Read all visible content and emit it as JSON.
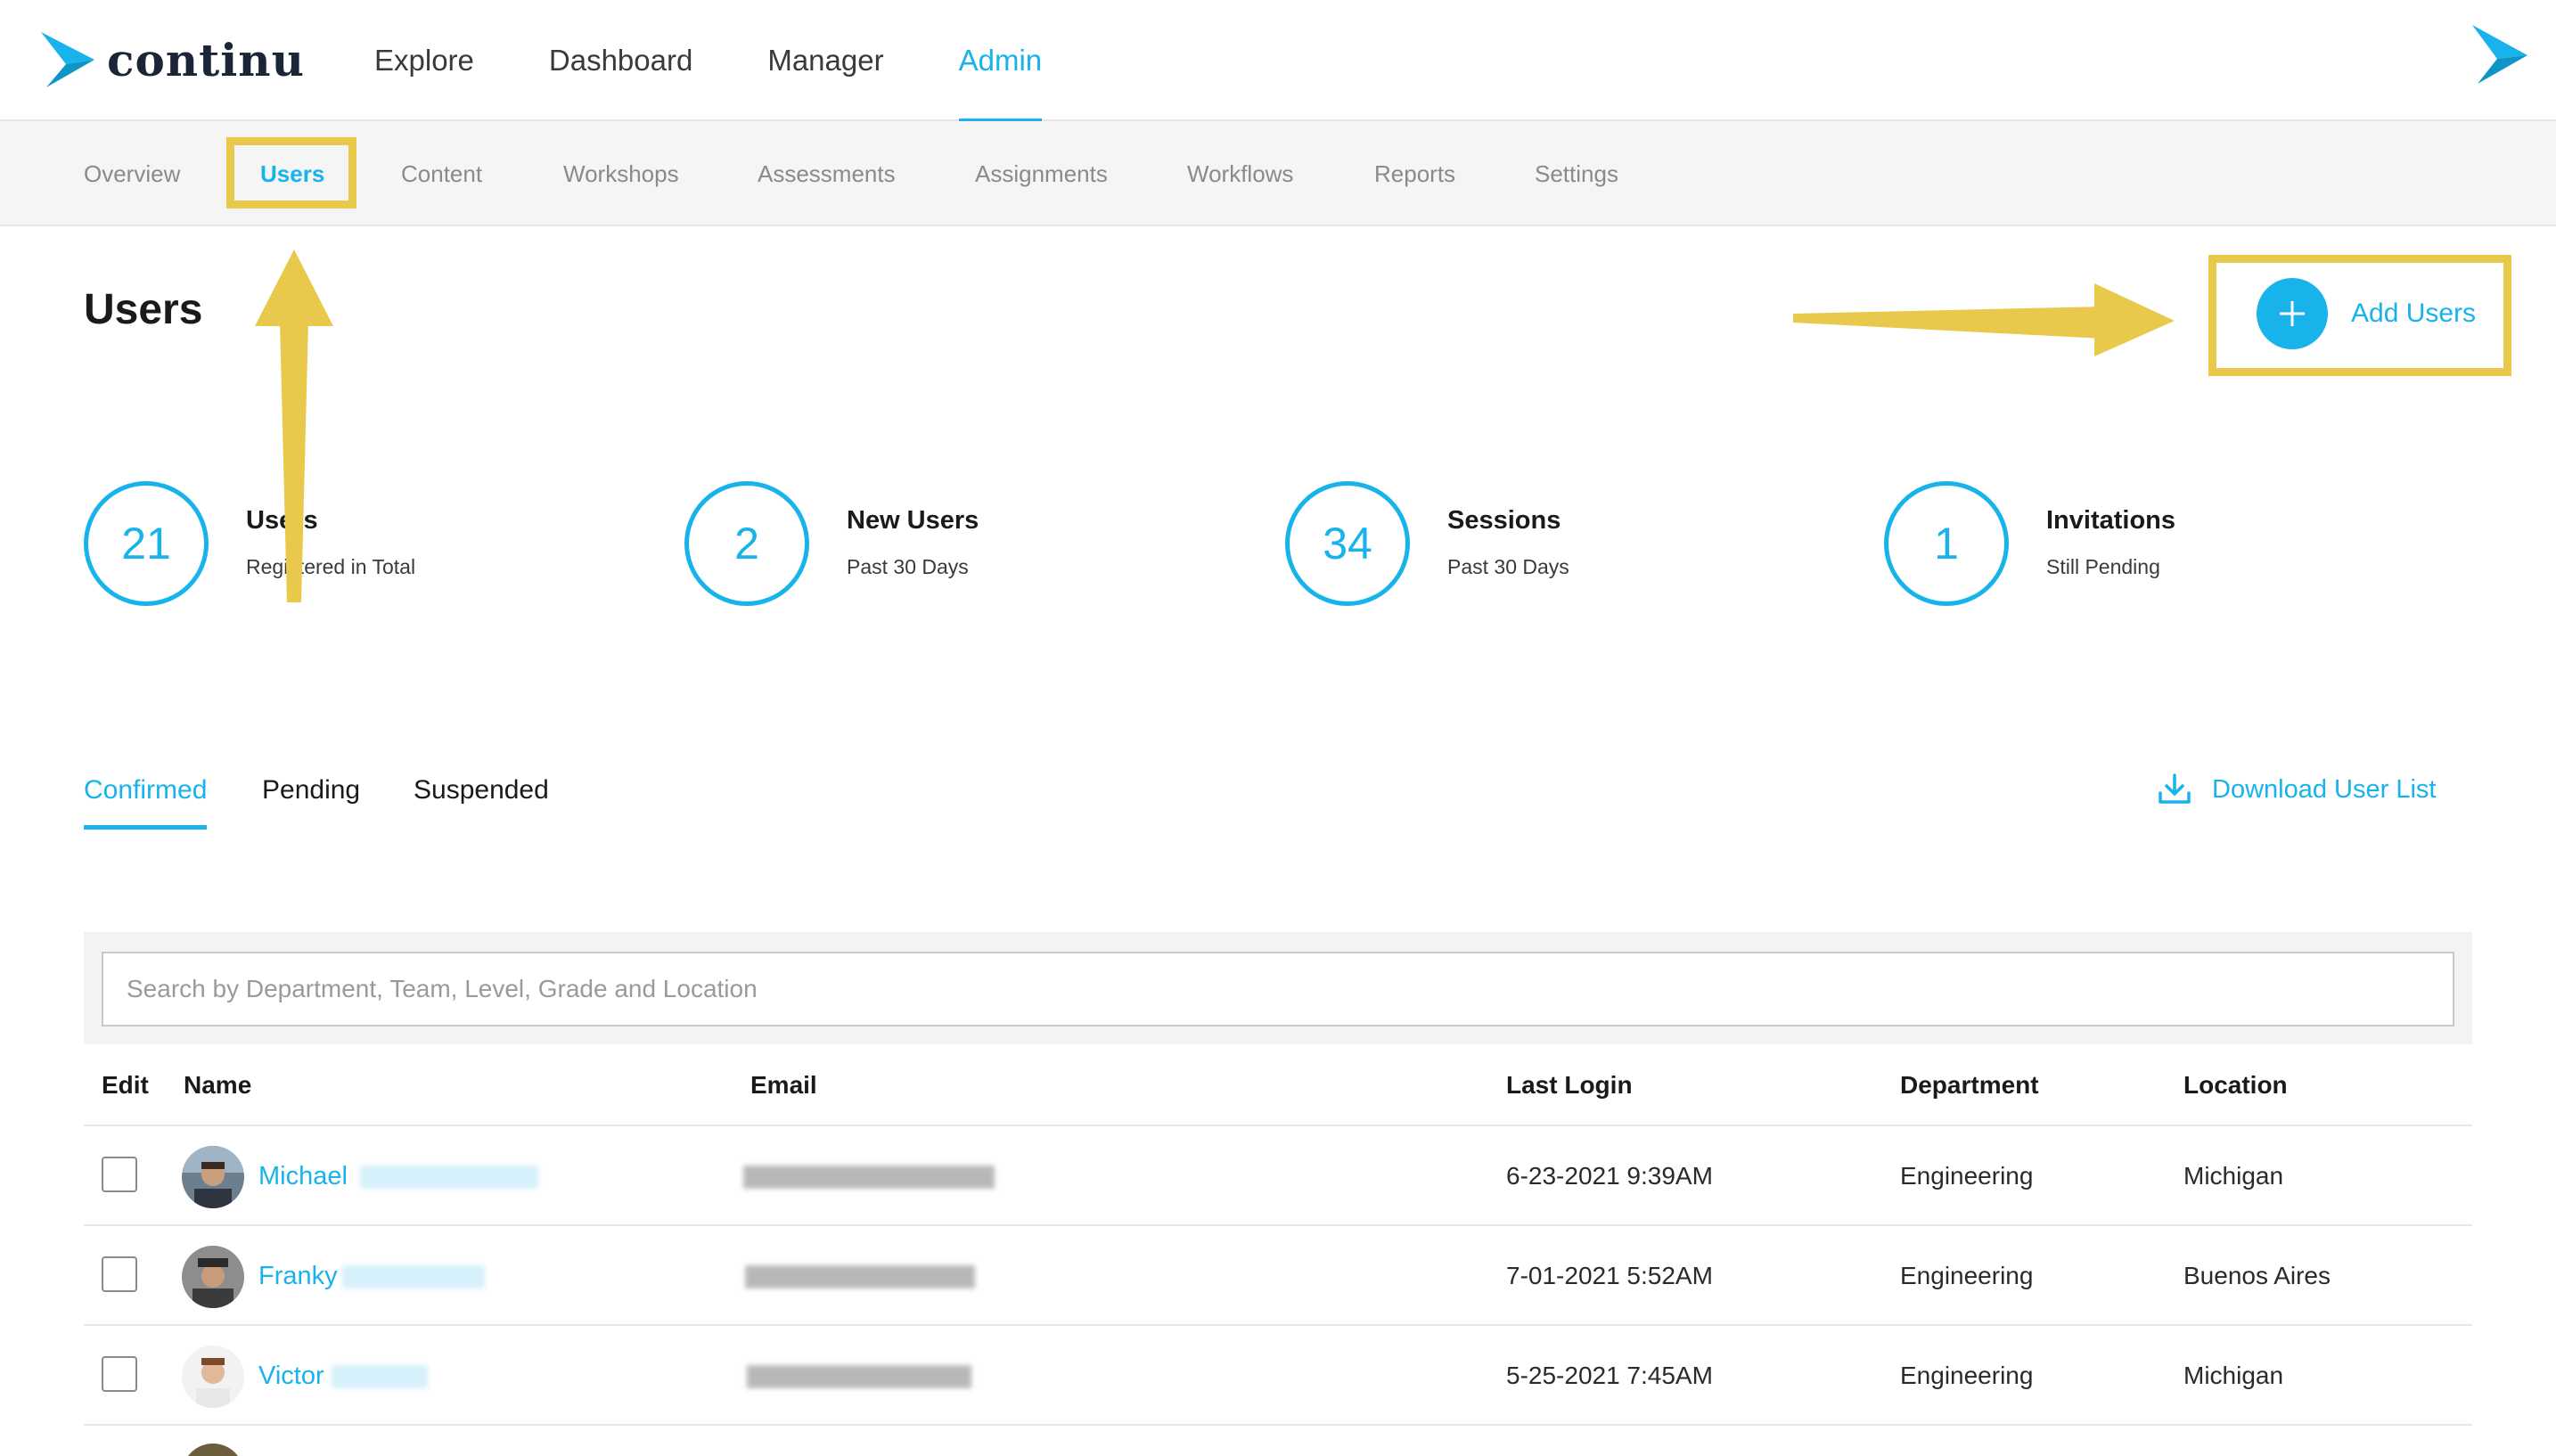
{
  "app": {
    "logo_text": "continu",
    "nav": [
      {
        "label": "Explore",
        "active": false
      },
      {
        "label": "Dashboard",
        "active": false
      },
      {
        "label": "Manager",
        "active": false
      },
      {
        "label": "Admin",
        "active": true
      }
    ]
  },
  "subnav": {
    "items": [
      {
        "label": "Overview",
        "active": false
      },
      {
        "label": "Users",
        "active": true
      },
      {
        "label": "Content",
        "active": false
      },
      {
        "label": "Workshops",
        "active": false
      },
      {
        "label": "Assessments",
        "active": false
      },
      {
        "label": "Assignments",
        "active": false
      },
      {
        "label": "Workflows",
        "active": false
      },
      {
        "label": "Reports",
        "active": false
      },
      {
        "label": "Settings",
        "active": false
      }
    ]
  },
  "page": {
    "title": "Users",
    "add_users_label": "Add Users"
  },
  "stats": [
    {
      "value": "21",
      "title": "Users",
      "subtitle": "Registered in Total"
    },
    {
      "value": "2",
      "title": "New Users",
      "subtitle": "Past 30 Days"
    },
    {
      "value": "34",
      "title": "Sessions",
      "subtitle": "Past 30 Days"
    },
    {
      "value": "1",
      "title": "Invitations",
      "subtitle": "Still Pending"
    }
  ],
  "tabs": [
    {
      "label": "Confirmed",
      "active": true
    },
    {
      "label": "Pending",
      "active": false
    },
    {
      "label": "Suspended",
      "active": false
    }
  ],
  "download_label": "Download User List",
  "search": {
    "placeholder": "Search by Department, Team, Level, Grade and Location",
    "value": ""
  },
  "table": {
    "headers": [
      "Edit",
      "Name",
      "Email",
      "Last Login",
      "Department",
      "Location"
    ],
    "rows": [
      {
        "name": "Michael",
        "last_login": "6-23-2021 9:39AM",
        "department": "Engineering",
        "location": "Michigan"
      },
      {
        "name": "Franky",
        "last_login": "7-01-2021 5:52AM",
        "department": "Engineering",
        "location": "Buenos Aires"
      },
      {
        "name": "Victor",
        "last_login": "5-25-2021 7:45AM",
        "department": "Engineering",
        "location": "Michigan"
      }
    ]
  },
  "colors": {
    "accent": "#17b3ea",
    "highlight": "#e8c94b",
    "brand_dark": "#1c2438"
  },
  "icons": {
    "logo": "chevron-arrow-icon",
    "add": "plus-icon",
    "download": "download-icon"
  }
}
